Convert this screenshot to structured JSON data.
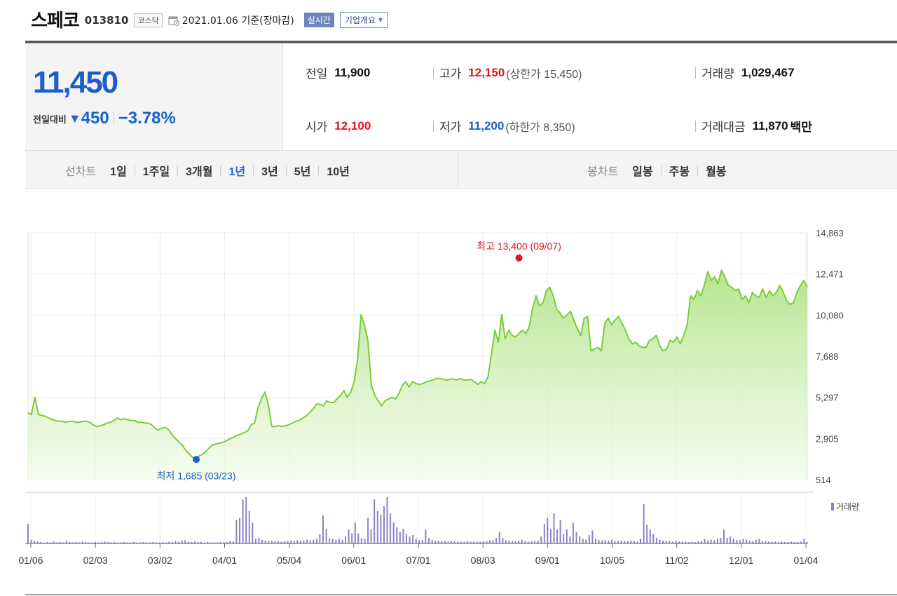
{
  "header": {
    "name": "스페코",
    "code": "013810",
    "market": "코스닥",
    "date": "2021.01.06 기준(장마감)",
    "realtime": "실시간",
    "corp_overview": "기업개요"
  },
  "price": {
    "current": "11,450",
    "compare_label": "전일대비",
    "change_icon": "down-triangle-icon",
    "change": "450",
    "change_pct": "−3.78%"
  },
  "stats": {
    "prev": {
      "label": "전일",
      "value": "11,900"
    },
    "high": {
      "label": "고가",
      "value": "12,150",
      "sub": "(상한가 15,450)"
    },
    "volume": {
      "label": "거래량",
      "value": "1,029,467"
    },
    "open": {
      "label": "시가",
      "value": "12,100"
    },
    "low": {
      "label": "저가",
      "value": "11,200",
      "sub": "(하한가 8,350)"
    },
    "amount": {
      "label": "거래대금",
      "value": "11,870",
      "unit": "백만"
    }
  },
  "periods": {
    "line_label": "선차트",
    "line_items": [
      "1일",
      "1주일",
      "3개월",
      "1년",
      "3년",
      "5년",
      "10년"
    ],
    "selected": "1년",
    "candle_label": "봉차트",
    "candle_items": [
      "일봉",
      "주봉",
      "월봉"
    ]
  },
  "colors": {
    "up": "#e0141e",
    "down": "#1a5fcb",
    "line": "#7ccc3a",
    "volume": "#8f7fc9"
  },
  "chart_data": {
    "type": "area",
    "y_ticks": [
      "14,863",
      "12,471",
      "10,080",
      "7,688",
      "5,297",
      "2,905",
      "514"
    ],
    "ylim": [
      514,
      14863
    ],
    "x_ticks": [
      "01/06",
      "02/03",
      "03/02",
      "04/01",
      "05/04",
      "06/01",
      "07/01",
      "08/03",
      "09/01",
      "10/05",
      "11/02",
      "12/01",
      "01/04"
    ],
    "grid": true,
    "high_annotation": {
      "text": "최고 13,400 (09/07)",
      "value": 13400,
      "date": "09/07"
    },
    "low_annotation": {
      "text": "최저 1,685 (03/23)",
      "value": 1685,
      "date": "03/23"
    },
    "series": [
      {
        "values": [
          4400,
          4300,
          5300,
          4300,
          4250,
          4200,
          4100,
          4000,
          3950,
          3900,
          3900,
          3850,
          3900,
          3900,
          3850,
          3850,
          3900,
          3900,
          3850,
          3700,
          3600,
          3650,
          3700,
          3800,
          3850,
          3950,
          4100,
          4000,
          4050,
          4000,
          3950,
          3950,
          3850,
          3850,
          3800,
          3800,
          3700,
          3500,
          3400,
          3500,
          3550,
          3400,
          3100,
          2900,
          2700,
          2500,
          2200,
          2000,
          1800,
          1685,
          1900,
          2000,
          2200,
          2400,
          2550,
          2600,
          2650,
          2700,
          2800,
          2900,
          3000,
          3100,
          3150,
          3250,
          3350,
          3700,
          3800,
          4700,
          5200,
          5600,
          4900,
          3600,
          3600,
          3650,
          3600,
          3650,
          3700,
          3800,
          3900,
          3950,
          4100,
          4200,
          4400,
          4600,
          4900,
          4900,
          4800,
          5100,
          5000,
          5000,
          5200,
          5400,
          5700,
          5300,
          5600,
          6200,
          7500,
          10100,
          9500,
          8600,
          6000,
          5400,
          5100,
          4800,
          5100,
          5200,
          5300,
          5200,
          5500,
          6000,
          6200,
          5900,
          6200,
          6100,
          6050,
          6100,
          6200,
          6250,
          6300,
          6400,
          6400,
          6350,
          6300,
          6350,
          6350,
          6300,
          6400,
          6300,
          6300,
          6350,
          6200,
          6050,
          6200,
          6100,
          6500,
          7800,
          9200,
          8500,
          10100,
          8700,
          9200,
          8900,
          8800,
          9000,
          9200,
          9000,
          9400,
          10500,
          11200,
          10600,
          10800,
          11500,
          11700,
          11200,
          10400,
          10200,
          9900,
          10100,
          10300,
          9800,
          9300,
          8900,
          9900,
          10000,
          8000,
          8100,
          8200,
          8000,
          9600,
          9900,
          9500,
          9800,
          10000,
          9600,
          9200,
          8700,
          8400,
          8500,
          8300,
          8200,
          8200,
          8600,
          8700,
          8900,
          8300,
          8000,
          8100,
          8600,
          8500,
          8800,
          8400,
          8900,
          9500,
          11200,
          11000,
          11500,
          11200,
          11800,
          12600,
          12100,
          12300,
          11900,
          12700,
          12300,
          11800,
          11700,
          11500,
          11600,
          11000,
          11200,
          10800,
          11400,
          11200,
          11100,
          11600,
          11100,
          11500,
          11200,
          11400,
          11800,
          11400,
          10900,
          10700,
          10800,
          11400,
          11800,
          12100,
          11700
        ]
      }
    ],
    "volume_label": "거래량",
    "volume": [
      0.42,
      0.08,
      0.05,
      0.04,
      0.03,
      0.02,
      0.03,
      0.02,
      0.04,
      0.02,
      0.03,
      0.02,
      0.05,
      0.03,
      0.02,
      0.03,
      0.02,
      0.04,
      0.03,
      0.02,
      0.02,
      0.03,
      0.02,
      0.03,
      0.04,
      0.03,
      0.02,
      0.03,
      0.02,
      0.02,
      0.03,
      0.02,
      0.02,
      0.03,
      0.02,
      0.02,
      0.03,
      0.02,
      0.02,
      0.03,
      0.02,
      0.02,
      0.03,
      0.02,
      0.04,
      0.03,
      0.05,
      0.04,
      0.06,
      0.07,
      0.04,
      0.03,
      0.04,
      0.03,
      0.03,
      0.02,
      0.03,
      0.02,
      0.02,
      0.02,
      0.03,
      0.02,
      0.03,
      0.05,
      0.05,
      0.5,
      0.55,
      0.95,
      1.0,
      0.7,
      0.45,
      0.1,
      0.12,
      0.08,
      0.06,
      0.05,
      0.06,
      0.05,
      0.05,
      0.04,
      0.05,
      0.05,
      0.06,
      0.05,
      0.07,
      0.06,
      0.06,
      0.08,
      0.07,
      0.08,
      0.1,
      0.2,
      0.6,
      0.32,
      0.12,
      0.1,
      0.08,
      0.1,
      0.08,
      0.15,
      0.3,
      0.22,
      0.45,
      0.22,
      0.12,
      0.1,
      0.55,
      0.3,
      0.95,
      0.7,
      0.62,
      0.8,
      1.0,
      0.65,
      0.45,
      0.35,
      0.25,
      0.32,
      0.2,
      0.15,
      0.18,
      0.1,
      0.07,
      0.08,
      0.3,
      0.12,
      0.08,
      0.06,
      0.06,
      0.05,
      0.05,
      0.04,
      0.05,
      0.05,
      0.04,
      0.04,
      0.04,
      0.05,
      0.04,
      0.04,
      0.04,
      0.04,
      0.05,
      0.05,
      0.06,
      0.07,
      0.12,
      0.25,
      0.12,
      0.07,
      0.06,
      0.05,
      0.05,
      0.06,
      0.08,
      0.05,
      0.04,
      0.05,
      0.05,
      0.06,
      0.15,
      0.42,
      0.55,
      0.3,
      0.65,
      0.3,
      0.5,
      0.2,
      0.3,
      0.15,
      0.45,
      0.25,
      0.15,
      0.1,
      0.08,
      0.18,
      0.28,
      0.1,
      0.08,
      0.06,
      0.07,
      0.06,
      0.08,
      0.05,
      0.05,
      0.06,
      0.05,
      0.05,
      0.06,
      0.05,
      0.04,
      0.1,
      0.85,
      0.4,
      0.3,
      0.2,
      0.12,
      0.08,
      0.06,
      0.05,
      0.05,
      0.04,
      0.05,
      0.04,
      0.04,
      0.04,
      0.03,
      0.04,
      0.03,
      0.04,
      0.05,
      0.1,
      0.06,
      0.08,
      0.07,
      0.1,
      0.12,
      0.3,
      0.12,
      0.15,
      0.1,
      0.08,
      0.07,
      0.1,
      0.08,
      0.06,
      0.05,
      0.08,
      0.1,
      0.05,
      0.05,
      0.04,
      0.04,
      0.04,
      0.03,
      0.04,
      0.03,
      0.03,
      0.04,
      0.03,
      0.03,
      0.04,
      0.1,
      0.03
    ]
  }
}
